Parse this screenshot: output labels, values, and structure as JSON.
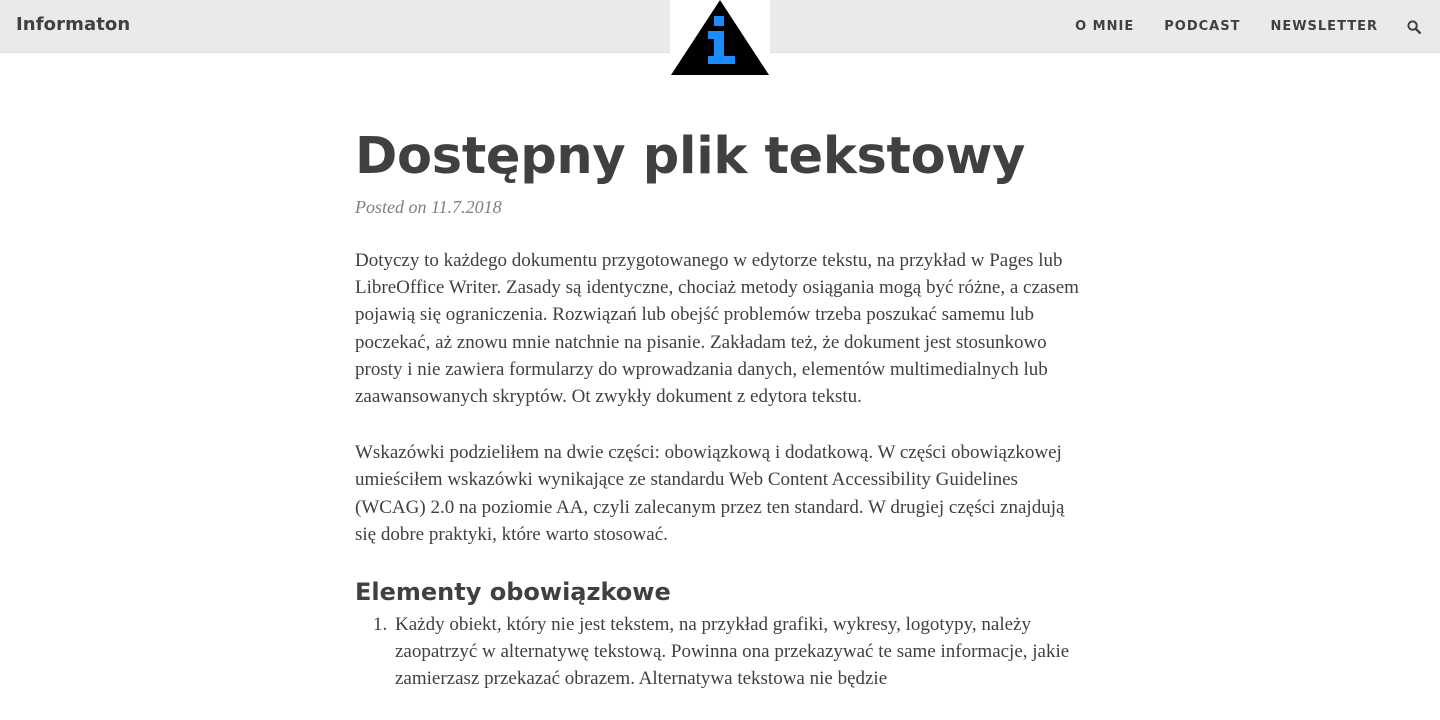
{
  "navbar": {
    "brand": "Informaton",
    "links": [
      {
        "label": "O MNIE"
      },
      {
        "label": "PODCAST"
      },
      {
        "label": "NEWSLETTER"
      }
    ],
    "search_icon": "search-icon"
  },
  "logo": {
    "icon": "info-triangle-logo",
    "colors": {
      "triangle": "#000000",
      "letter": "#1a8cff"
    }
  },
  "article": {
    "title": "Dostępny plik tekstowy",
    "meta": "Posted on 11.7.2018",
    "paragraphs": [
      "Dotyczy to każdego dokumentu przygotowanego w edytorze tekstu, na przykład w Pages lub LibreOffice Writer. Zasady są identyczne, chociaż metody osiągania mogą być różne, a czasem pojawią się ograniczenia. Rozwiązań lub obejść problemów trzeba poszukać samemu lub poczekać, aż znowu mnie natchnie na pisanie. Zakładam też, że dokument jest stosunkowo prosty i nie zawiera formularzy do wprowadzania danych, elementów multimedialnych lub zaawansowanych skryptów. Ot zwykły dokument z edytora tekstu.",
      "Wskazówki podzieliłem na dwie części: obowiązkową i dodatkową. W części obowiązkowej umieściłem wskazówki wynikające ze standardu Web Content Accessibility Guidelines (WCAG) 2.0 na poziomie AA, czyli zalecanym przez ten standard. W drugiej części znajdują się dobre praktyki, które warto stosować."
    ],
    "section_heading": "Elementy obowiązkowe",
    "list_items": [
      {
        "marker": "1.",
        "text": "Każdy obiekt, który nie jest tekstem, na przykład grafiki, wykresy, logotypy, należy zaopatrzyć w alternatywę tekstową. Powinna ona przekazywać te same informacje, jakie zamierzasz przekazać obrazem. Alternatywa tekstowa nie będzie"
      }
    ]
  },
  "colors": {
    "navbar_bg": "#eaeaea",
    "text": "#404040",
    "meta": "#808080"
  }
}
